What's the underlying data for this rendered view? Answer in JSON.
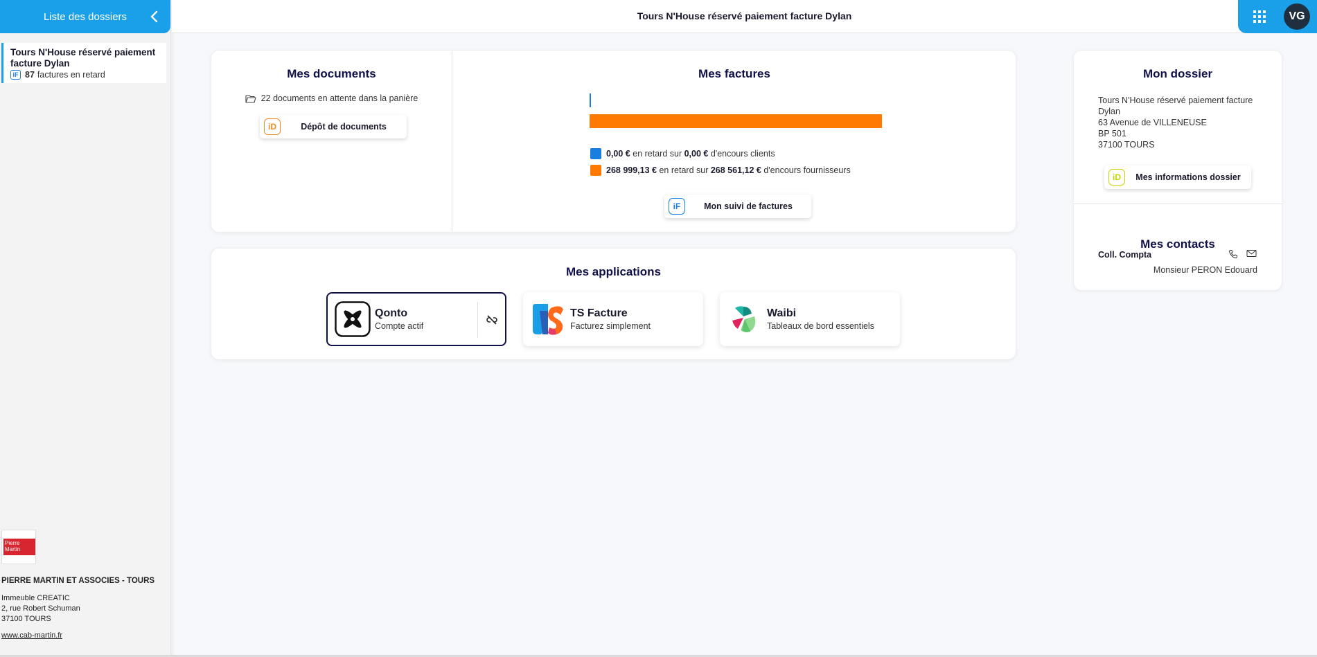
{
  "sidebar": {
    "header_label": "Liste des dossiers",
    "dossier": {
      "title": "Tours N'House réservé paiement facture Dylan",
      "tag": "iF",
      "count": "87",
      "count_label": "factures en retard"
    },
    "firm": {
      "logo_text": "Pierre Martin",
      "name": "PIERRE MARTIN ET ASSOCIES - TOURS",
      "address_line1": "Immeuble CREATIC",
      "address_line2": "2, rue Robert Schuman",
      "address_line3": "37100 TOURS",
      "website": "www.cab-martin.fr"
    }
  },
  "topbar": {
    "title": "Tours N'House réservé paiement facture Dylan",
    "avatar_initials": "VG"
  },
  "documents": {
    "title": "Mes documents",
    "waiting_text": "22 documents en attente dans la panière",
    "button_badge": "iD",
    "button_label": "Dépôt de documents"
  },
  "factures": {
    "title": "Mes factures",
    "clients_late": "0,00 €",
    "clients_mid": "en retard sur",
    "clients_total": "0,00 €",
    "clients_suffix": "d'encours clients",
    "suppliers_late": "268 999,13 €",
    "suppliers_mid": "en retard sur",
    "suppliers_total": "268 561,12 €",
    "suppliers_suffix": "d'encours fournisseurs",
    "button_badge": "iF",
    "button_label": "Mon suivi de factures",
    "colors": {
      "clients": "#1a7ee0",
      "suppliers": "#ff7a00"
    }
  },
  "applications": {
    "title": "Mes applications",
    "apps": [
      {
        "name": "Qonto",
        "desc": "Compte actif"
      },
      {
        "name": "TS Facture",
        "desc": "Facturez simplement"
      },
      {
        "name": "Waibi",
        "desc": "Tableaux de bord essentiels"
      }
    ]
  },
  "dossier": {
    "title": "Mon dossier",
    "address_line1": "Tours N'House réservé paiement facture",
    "address_line2": "Dylan",
    "address_line3": "63 Avenue de VILLENEUSE",
    "address_line4": "BP 501",
    "address_line5": "37100 TOURS",
    "button_badge": "iD",
    "button_label": "Mes informations dossier",
    "contacts_title": "Mes contacts",
    "contact_role": "Coll. Compta",
    "contact_name": "Monsieur PERON Edouard"
  }
}
